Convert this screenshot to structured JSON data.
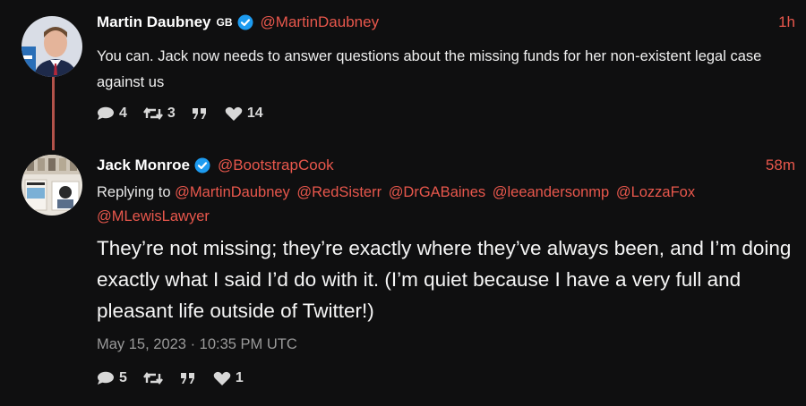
{
  "tweets": [
    {
      "fullname": "Martin Daubney",
      "flag": "GB",
      "handle": "@MartinDaubney",
      "time": "1h",
      "content": "You can. Jack now needs to answer questions about the missing funds for her non-existent legal case against us",
      "stats": {
        "replies": "4",
        "retweets": "3",
        "likes": "14"
      }
    },
    {
      "fullname": "Jack Monroe",
      "handle": "@BootstrapCook",
      "time": "58m",
      "replying_label": "Replying to",
      "mentions": [
        "@MartinDaubney",
        "@RedSisterr",
        "@DrGABaines",
        "@leeandersonmp",
        "@LozzaFox",
        "@MLewisLawyer"
      ],
      "content": "They’re not missing; they’re exactly where they’ve always been, and I’m doing exactly what I said I’d do with it. (I’m quiet because I have a very full and pleasant life outside of Twitter!)",
      "date": "May 15, 2023 · 10:35 PM UTC",
      "stats": {
        "replies": "5",
        "likes": "1"
      }
    }
  ],
  "colors": {
    "background": "#0f0f10",
    "accent": "#e8574c",
    "verified": "#1d9bf0",
    "thread_line": "#b2524a"
  },
  "icons": [
    "reply-icon",
    "retweet-icon",
    "quote-icon",
    "heart-icon",
    "verified-badge-icon"
  ]
}
